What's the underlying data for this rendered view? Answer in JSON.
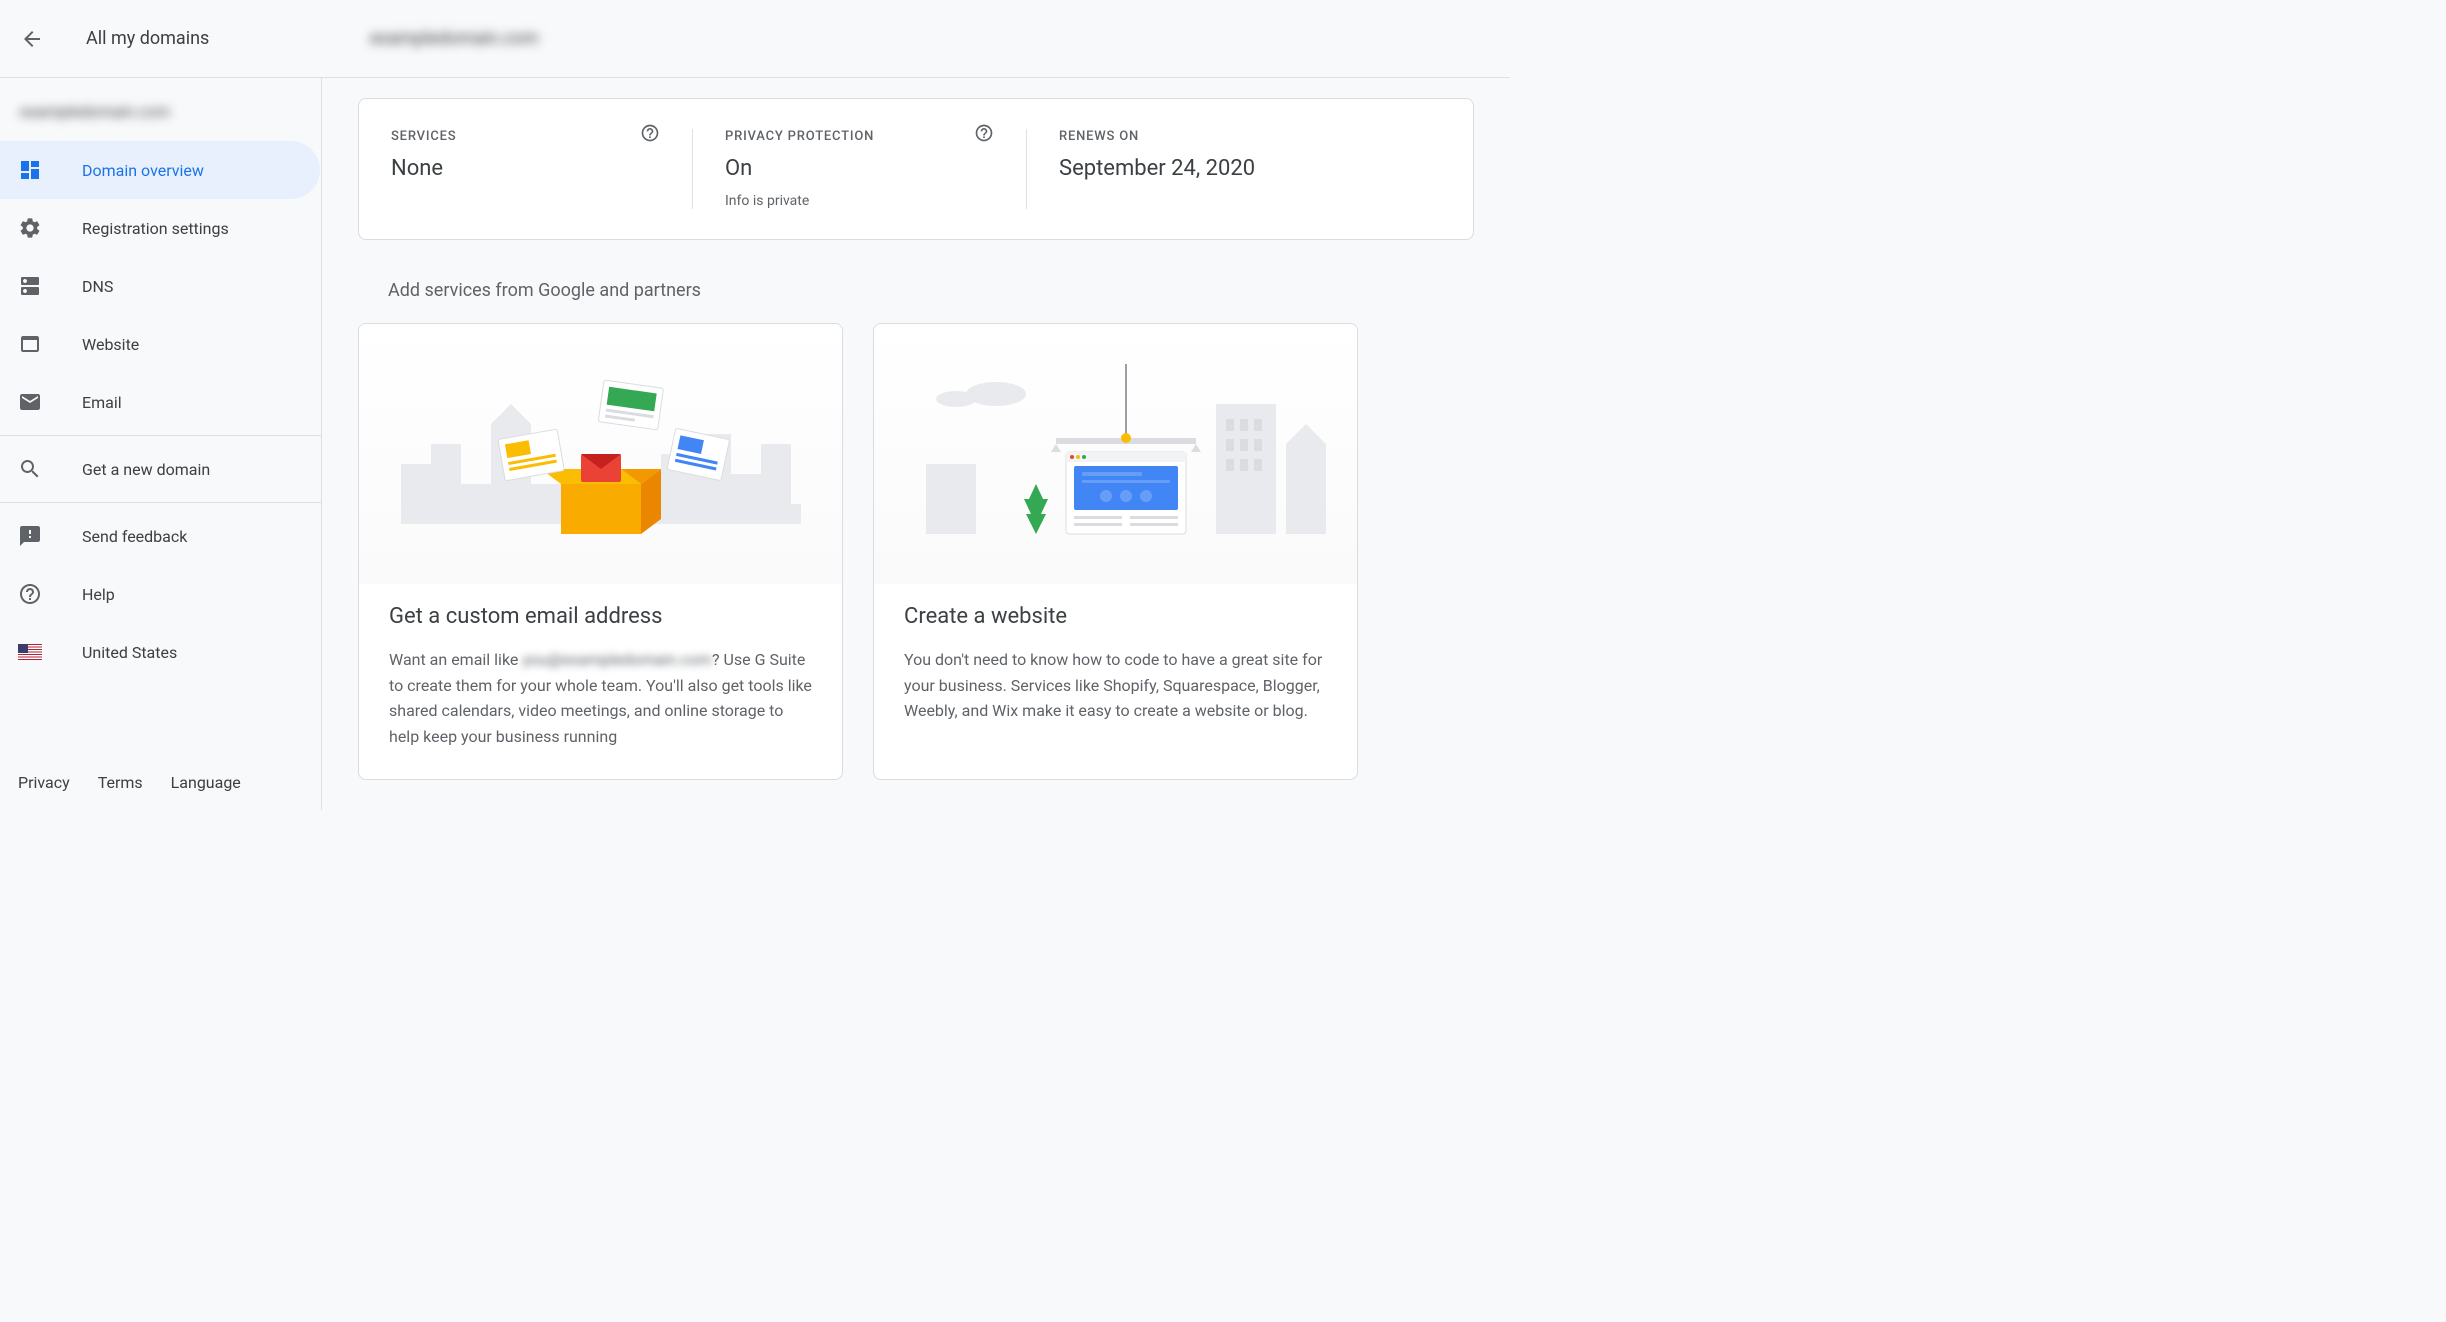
{
  "header": {
    "title": "All my domains",
    "domain": "exampledomain.com"
  },
  "sidebar": {
    "domain": "exampledomain.com",
    "items": [
      {
        "label": "Domain overview"
      },
      {
        "label": "Registration settings"
      },
      {
        "label": "DNS"
      },
      {
        "label": "Website"
      },
      {
        "label": "Email"
      },
      {
        "label": "Get a new domain"
      },
      {
        "label": "Send feedback"
      },
      {
        "label": "Help"
      },
      {
        "label": "United States"
      }
    ]
  },
  "footer": {
    "privacy": "Privacy",
    "terms": "Terms",
    "language": "Language"
  },
  "info": {
    "services": {
      "label": "SERVICES",
      "value": "None"
    },
    "privacy": {
      "label": "PRIVACY PROTECTION",
      "value": "On",
      "sub": "Info is private"
    },
    "renews": {
      "label": "RENEWS ON",
      "value": "September 24, 2020"
    }
  },
  "section_title": "Add services from Google and partners",
  "cards": {
    "email": {
      "title": "Get a custom email address",
      "text_pre": "Want an email like ",
      "text_blur": "you@exampledomain.com",
      "text_post": "? Use G Suite to create them for your whole team. You'll also get tools like shared calendars, video meetings, and online storage to help keep your business running"
    },
    "website": {
      "title": "Create a website",
      "text": "You don't need to know how to code to have a great site for your business. Services like Shopify, Squarespace, Blogger, Weebly, and Wix make it easy to create a website or blog."
    }
  }
}
